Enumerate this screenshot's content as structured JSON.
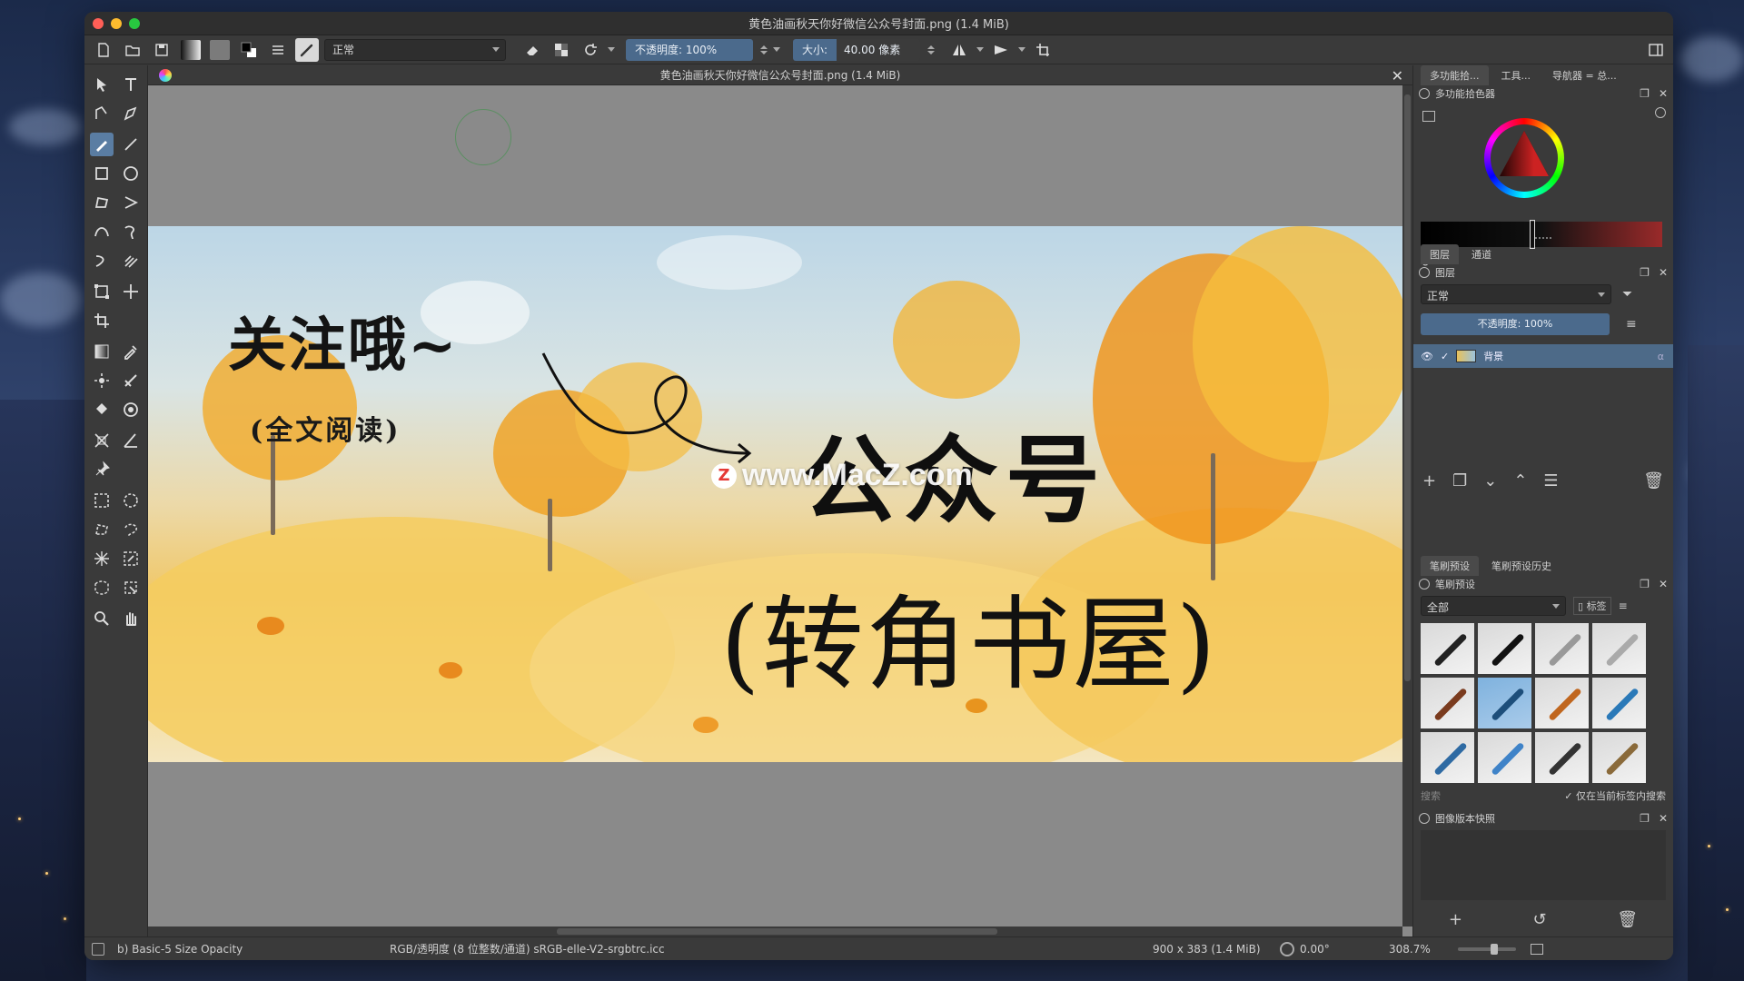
{
  "window": {
    "title": "黄色油画秋天你好微信公众号封面.png (1.4 MiB)"
  },
  "toolbar": {
    "blend_mode": "正常",
    "opacity_label": "不透明度: 100%",
    "size_label": "大小:",
    "size_value": "40.00 像素"
  },
  "document": {
    "tab_title": "黄色油画秋天你好微信公众号封面.png (1.4 MiB)",
    "close_glyph": "✕"
  },
  "artwork": {
    "text_follow": "关注哦~",
    "text_read": "(全文阅读)",
    "text_official": "公众号",
    "text_corner": "(转角书屋)",
    "watermark_logo": "Z",
    "watermark_text": "www.MacZ.com"
  },
  "dockers": {
    "top_tabs": [
      "多功能拾...",
      "工具...",
      "导航器 = 总..."
    ],
    "color_selector_title": "多功能拾色器",
    "layer_tabs": [
      "图层",
      "通道"
    ],
    "layers_title": "图层",
    "layers_blend_mode": "正常",
    "layers_opacity": "不透明度: 100%",
    "layer_name": "背景",
    "layer_alpha_glyph": "α",
    "brush_tabs": [
      "笔刷预设",
      "笔刷预设历史"
    ],
    "brush_title": "笔刷预设",
    "brush_filter": "全部",
    "brush_tag_button": "标签",
    "brush_search_placeholder": "搜索",
    "brush_search_in_tag": "仅在当前标签内搜索",
    "snapshot_title": "图像版本快照"
  },
  "status": {
    "brush_preset": "b) Basic-5 Size Opacity",
    "color_profile": "RGB/透明度 (8 位整数/通道)  sRGB-elle-V2-srgbtrc.icc",
    "image_size": "900 x 383 (1.4 MiB)",
    "rotation": "0.00°",
    "zoom": "308.7%"
  },
  "icons": [
    "new-document-icon",
    "open-icon",
    "save-icon",
    "gradient-icon",
    "pattern-icon",
    "fg-bg-color-icon",
    "brush-settings-icon",
    "brush-preset-icon",
    "eraser-icon",
    "alpha-lock-icon",
    "reload-icon",
    "mirror-horizontal-icon",
    "mirror-vertical-icon",
    "wrap-around-icon",
    "docker-toggle-icon"
  ],
  "colors": {
    "accent": "#5a7da3",
    "slider_blue": "#4b6a8c",
    "window_bg": "#3a3a3a"
  }
}
